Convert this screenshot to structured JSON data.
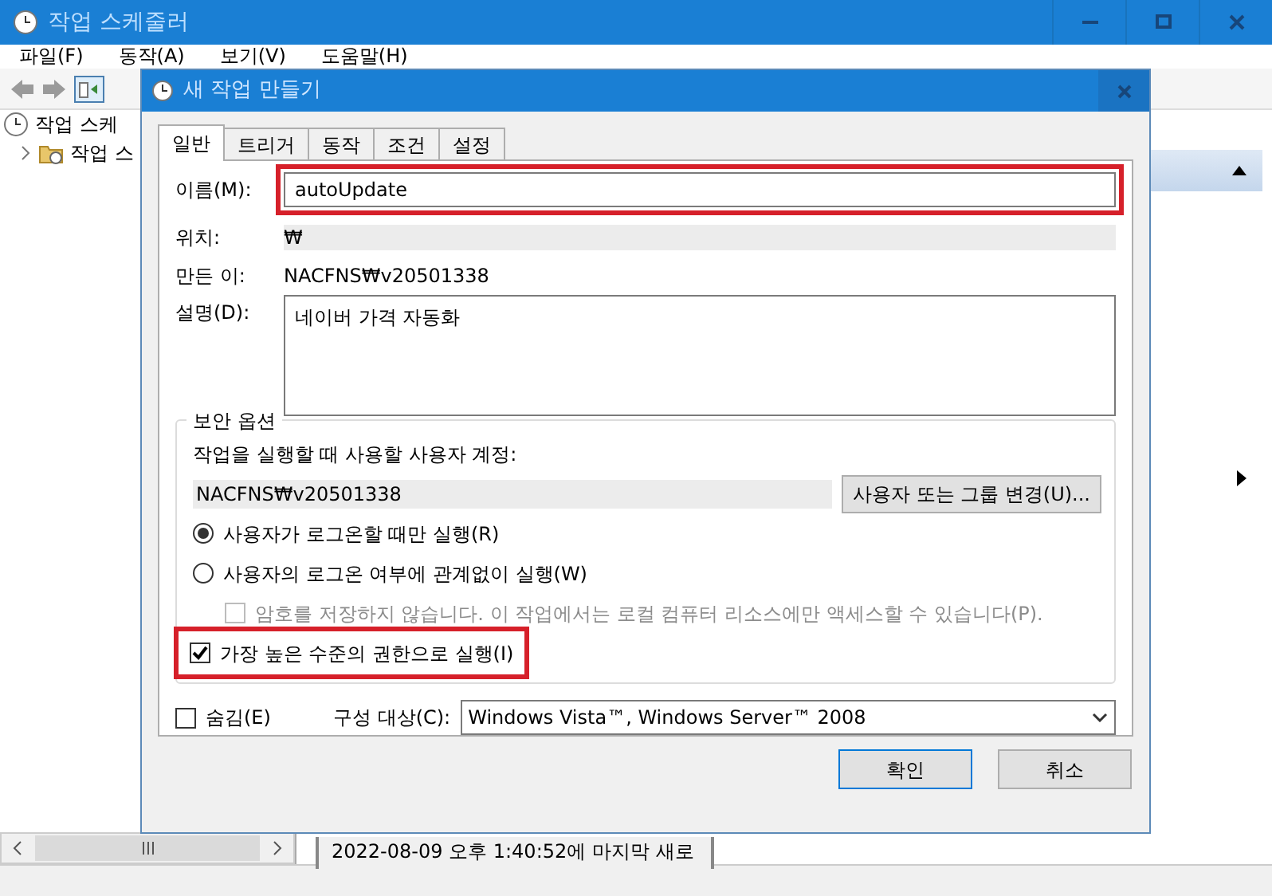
{
  "main_window": {
    "title": "작업 스케줄러",
    "menu": [
      "파일(F)",
      "동작(A)",
      "보기(V)",
      "도움말(H)"
    ],
    "tree": [
      {
        "label": "작업 스케",
        "children": [
          {
            "label": "작업 스"
          }
        ]
      }
    ],
    "status_text": "2022-08-09 오후 1:40:52에 마지막 새로"
  },
  "dialog": {
    "title": "새 작업 만들기",
    "tabs": [
      {
        "label": "일반",
        "selected": true
      },
      {
        "label": "트리거",
        "selected": false
      },
      {
        "label": "동작",
        "selected": false
      },
      {
        "label": "조건",
        "selected": false
      },
      {
        "label": "설정",
        "selected": false
      }
    ],
    "name": {
      "label": "이름(M):",
      "value": "autoUpdate",
      "highlighted": true
    },
    "location": {
      "label": "위치:",
      "value": "₩"
    },
    "author": {
      "label": "만든 이:",
      "value": "NACFNS₩v20501338"
    },
    "description": {
      "label": "설명(D):",
      "value": "네이버 가격 자동화"
    },
    "security": {
      "title": "보안 옵션",
      "account_label": "작업을 실행할 때 사용할 사용자 계정:",
      "account": "NACFNS₩v20501338",
      "change_button": "사용자 또는 그룹 변경(U)...",
      "options": [
        {
          "kind": "radio",
          "label": "사용자가 로그온할 때만 실행(R)",
          "selected": true
        },
        {
          "kind": "radio",
          "label": "사용자의 로그온 여부에 관계없이 실행(W)",
          "selected": false,
          "children": [
            {
              "kind": "checkbox",
              "label": "암호를 저장하지 않습니다. 이 작업에서는 로컬 컴퓨터 리소스에만 액세스할 수 있습니다(P).",
              "checked": false,
              "disabled": true
            }
          ]
        },
        {
          "kind": "checkbox",
          "label": "가장 높은 수준의 권한으로 실행(I)",
          "checked": true,
          "highlighted": true
        }
      ]
    },
    "hidden": {
      "label": "숨김(E)",
      "checked": false
    },
    "configure": {
      "label": "구성 대상(C):",
      "value": "Windows Vista™, Windows Server™ 2008"
    },
    "buttons": [
      "확인",
      "취소"
    ]
  }
}
